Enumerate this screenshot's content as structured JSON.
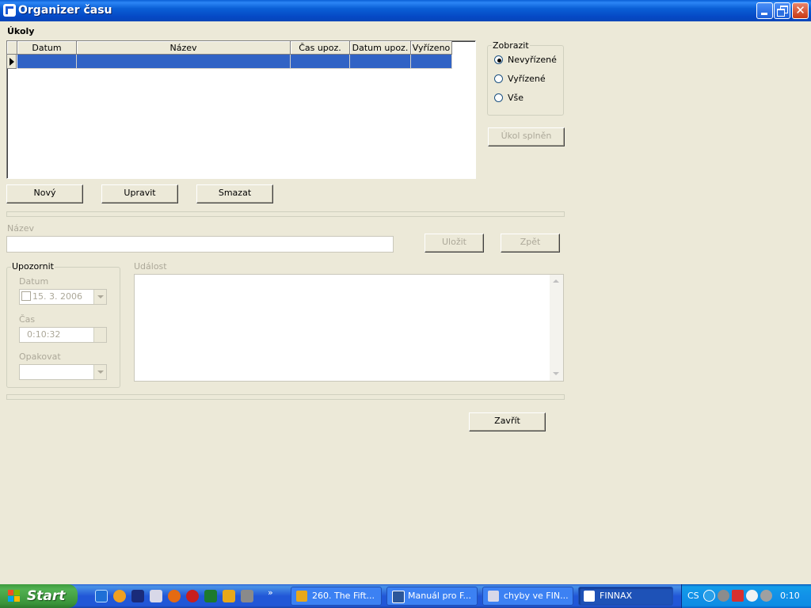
{
  "window": {
    "title": "Organizer času"
  },
  "tasks_section": {
    "label": "Úkoly"
  },
  "grid": {
    "columns": [
      "Datum",
      "Název",
      "Čas upoz.",
      "Datum upoz.",
      "Vyřízeno"
    ],
    "rows": [
      [
        "",
        "",
        "",
        "",
        ""
      ]
    ]
  },
  "filter": {
    "title": "Zobrazit",
    "options": [
      "Nevyřízené",
      "Vyřízené",
      "Vše"
    ],
    "selected": "Nevyřízené"
  },
  "buttons": {
    "complete": "Úkol splněn",
    "new": "Nový",
    "edit": "Upravit",
    "delete": "Smazat",
    "save": "Uložit",
    "back": "Zpět",
    "close": "Zavřít"
  },
  "editor": {
    "name_label": "Název",
    "name_value": "",
    "event_label": "Událost",
    "event_value": ""
  },
  "reminder": {
    "title": "Upozornit",
    "date_label": "Datum",
    "date_value": "15. 3. 2006",
    "time_label": "Čas",
    "time_value": "0:10:32",
    "repeat_label": "Opakovat",
    "repeat_value": ""
  },
  "taskbar": {
    "start_label": "Start",
    "quick_launch": [
      "ie-icon",
      "media-player-icon",
      "save-icon",
      "document-icon",
      "firefox-icon",
      "opera-icon",
      "excel-icon",
      "app-icon",
      "winamp-icon"
    ],
    "tasks": [
      {
        "label": "260. The Fift...",
        "icon": "winamp-icon",
        "active": false
      },
      {
        "label": "Manuál pro F...",
        "icon": "word-icon",
        "active": false
      },
      {
        "label": "chyby ve FIN...",
        "icon": "document-icon",
        "active": false
      },
      {
        "label": "FINNAX",
        "icon": "finnax-icon",
        "active": true
      }
    ],
    "language": "CS",
    "clock": "0:10"
  },
  "colors": {
    "titlebar": "#0A5FD6",
    "selection": "#3163C5",
    "face": "#ECE9D8",
    "taskbar": "#2157D7",
    "start": "#3A943A"
  }
}
